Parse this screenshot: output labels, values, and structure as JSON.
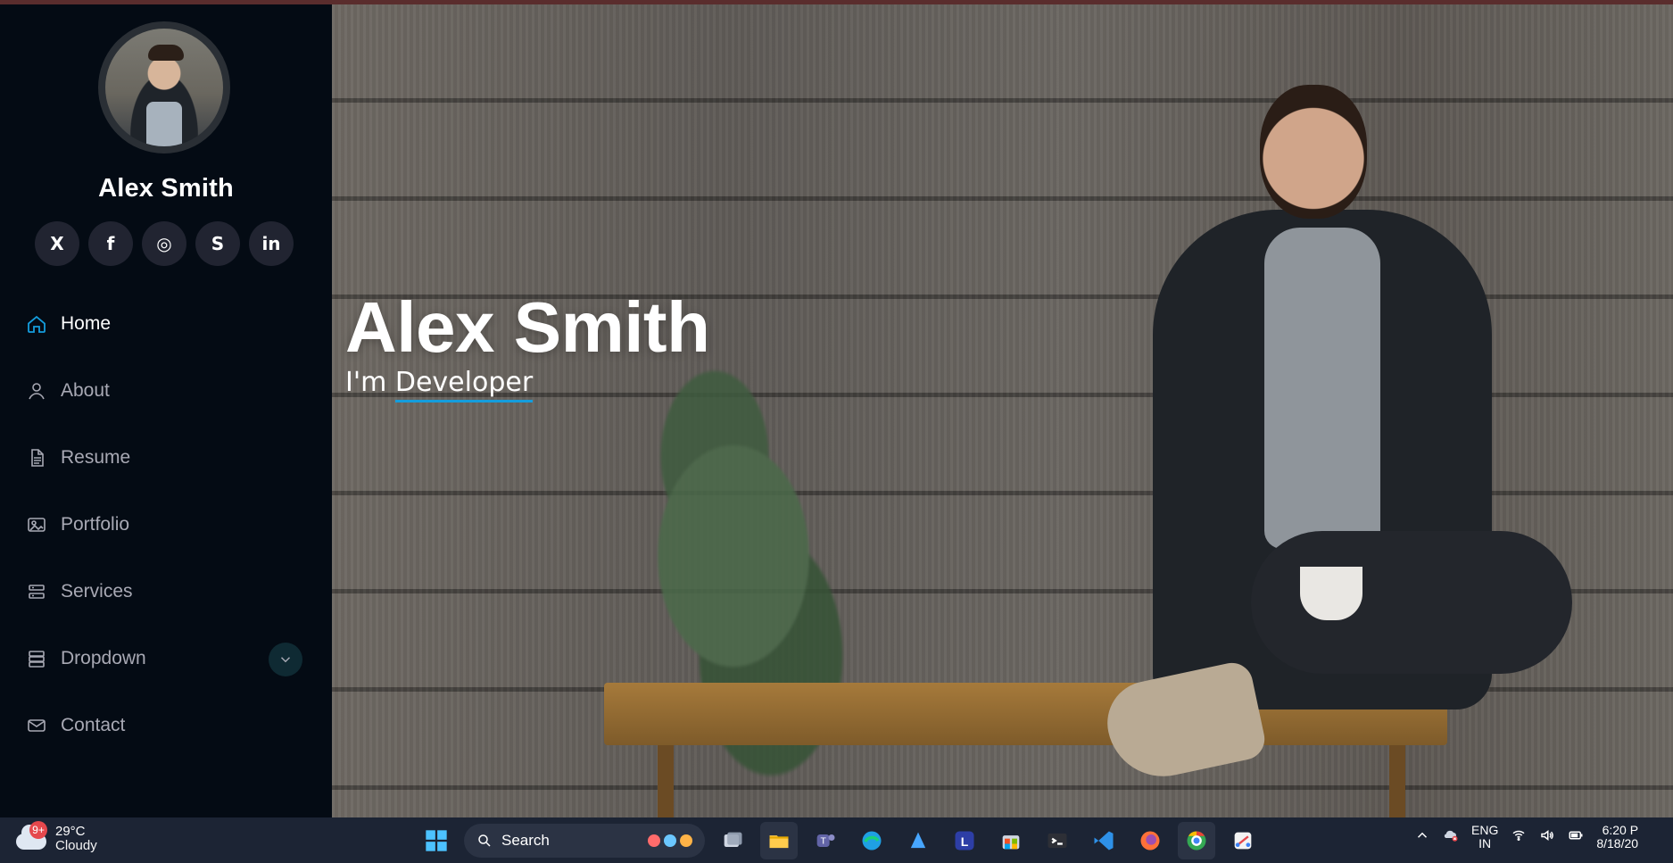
{
  "colors": {
    "sidebar_bg": "#040b14",
    "accent": "#149ddd",
    "nav_inactive": "#a8a9b4",
    "social_bg": "#212431",
    "taskbar_bg": "#1c2434"
  },
  "sidebar": {
    "name": "Alex Smith",
    "socials": [
      {
        "label": "X",
        "icon": "x-icon"
      },
      {
        "label": "f",
        "icon": "facebook-icon"
      },
      {
        "label": "◎",
        "icon": "instagram-icon"
      },
      {
        "label": "S",
        "icon": "skype-icon"
      },
      {
        "label": "in",
        "icon": "linkedin-icon"
      }
    ],
    "nav": [
      {
        "label": "Home",
        "icon": "home-icon",
        "active": true
      },
      {
        "label": "About",
        "icon": "person-icon"
      },
      {
        "label": "Resume",
        "icon": "document-icon"
      },
      {
        "label": "Portfolio",
        "icon": "image-icon"
      },
      {
        "label": "Services",
        "icon": "services-icon"
      },
      {
        "label": "Dropdown",
        "icon": "dropdown-icon",
        "has_chevron": true
      },
      {
        "label": "Contact",
        "icon": "mail-icon"
      }
    ]
  },
  "hero": {
    "title": "Alex Smith",
    "prefix": "I'm ",
    "typed": "Developer"
  },
  "taskbar": {
    "weather": {
      "badge": "9+",
      "temp": "29°C",
      "condition": "Cloudy"
    },
    "search_label": "Search",
    "tray": {
      "lang_line1": "ENG",
      "lang_line2": "IN",
      "time_line1": "6:20 P",
      "time_line2": "8/18/20"
    }
  }
}
